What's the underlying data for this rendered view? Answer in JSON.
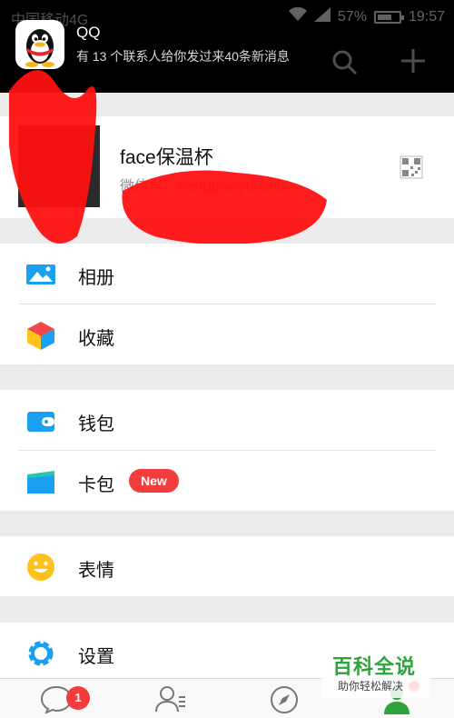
{
  "statusbar": {
    "carrier": "中国移动4G",
    "battery": "57%",
    "time": "19:57"
  },
  "notification": {
    "app": "QQ",
    "message": "有 13 个联系人给你发过来40条新消息"
  },
  "profile": {
    "name": "face保温杯",
    "id": "微信号：Fengpiaoyunchui"
  },
  "menu": {
    "album": "相册",
    "favorites": "收藏",
    "wallet": "钱包",
    "cards": "卡包",
    "cards_badge": "New",
    "stickers": "表情",
    "settings": "设置"
  },
  "tabbar": {
    "chats_badge": "1"
  },
  "watermark": {
    "title": "百科全说",
    "subtitle": "助你轻松解决"
  },
  "colors": {
    "accent_red": "#f33c3c",
    "icon_blue": "#1aa0f0",
    "brand_green": "#2ea33b"
  }
}
